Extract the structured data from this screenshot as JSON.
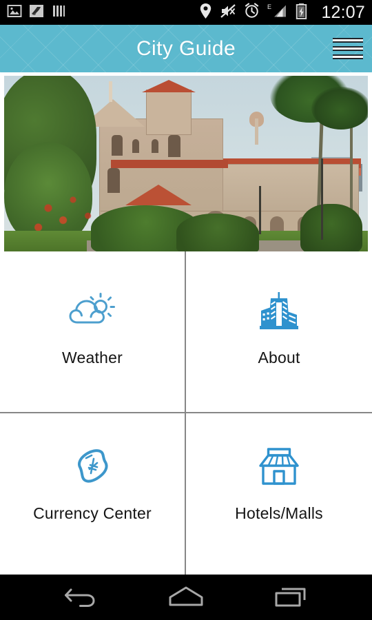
{
  "status_bar": {
    "clock": "12:07",
    "left_icons": [
      {
        "name": "image-icon",
        "label": "Screenshot saved"
      },
      {
        "name": "bird-notification-icon",
        "label": "App notification"
      },
      {
        "name": "bars-icon",
        "label": "Equalizer"
      }
    ],
    "right_icons": [
      {
        "name": "location-pin-icon",
        "label": "Location on"
      },
      {
        "name": "mute-icon",
        "label": "Sound muted"
      },
      {
        "name": "alarm-clock-icon",
        "label": "Alarm set"
      },
      {
        "name": "signal-bars-icon",
        "label": "E"
      },
      {
        "name": "battery-charging-icon",
        "label": "Charging"
      }
    ],
    "network_type": "E",
    "background": "#000000"
  },
  "app_bar": {
    "title": "City Guide",
    "menu_icon": "hamburger-menu-icon",
    "background": "#5cb9ce",
    "title_color": "#ffffff"
  },
  "hero": {
    "name": "city-landmark-photo",
    "alt": "Aga Khan Palace with red tile roofs, gardens and palm trees"
  },
  "tiles": [
    {
      "label": "Weather",
      "icon": "weather-cloud-sun-icon",
      "color": "#4d9fce"
    },
    {
      "label": "About",
      "icon": "city-buildings-icon",
      "color": "#2f92ce"
    },
    {
      "label": "Currency Center",
      "icon": "banknote-icon",
      "color": "#3d97cb"
    },
    {
      "label": "Hotels/Malls",
      "icon": "storefront-icon",
      "color": "#2f92ce"
    }
  ],
  "nav_bar": {
    "background": "#000000",
    "buttons": [
      {
        "name": "back-button",
        "icon": "back-arrow-icon"
      },
      {
        "name": "home-button",
        "icon": "home-icon"
      },
      {
        "name": "recent-apps-button",
        "icon": "recent-apps-icon"
      }
    ]
  },
  "theme": {
    "accent": "#5cb9ce",
    "icon_blue": "#3d97cb",
    "divider": "#868686",
    "page_background": "#ffffff",
    "text": "#141414"
  }
}
